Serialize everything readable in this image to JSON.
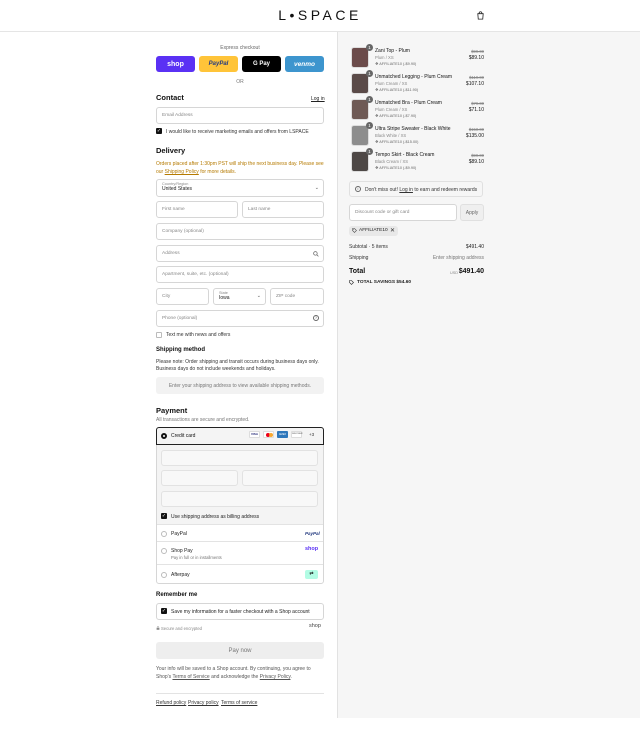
{
  "brand": {
    "logo": "L•SPACE"
  },
  "express": {
    "label": "Express checkout",
    "shop": "shop",
    "paypal": "PayPal",
    "gpay": "G Pay",
    "venmo": "venmo",
    "or": "OR"
  },
  "contact": {
    "title": "Contact",
    "login": "Log in",
    "email_placeholder": "Email Address",
    "marketing": "I would like to receive marketing emails and offers from LSPACE"
  },
  "delivery": {
    "title": "Delivery",
    "notice_a": "Orders placed after 1:30pm PST will ship the next business day. Please see our",
    "notice_link": "Shipping Policy",
    "notice_b": "for more details.",
    "country_label": "Country/Region",
    "country_value": "United States",
    "first_name": "First name",
    "last_name": "Last name",
    "company": "Company (optional)",
    "address": "Address",
    "apartment": "Apartment, suite, etc. (optional)",
    "city": "City",
    "state_label": "State",
    "state_value": "Iowa",
    "zip": "ZIP code",
    "phone": "Phone (optional)",
    "text_me": "Text me with news and offers"
  },
  "shipping_method": {
    "title": "Shipping method",
    "note_a": "Please note: Order shipping and transit occurs during business days only.",
    "note_b": "Business days do not include weekends and holidays.",
    "placeholder": "Enter your shipping address to view available shipping methods."
  },
  "payment": {
    "title": "Payment",
    "subtitle": "All transactions are secure and encrypted.",
    "credit_card": "Credit card",
    "more_cards": "+3",
    "visa": "VISA",
    "amex": "AMEX",
    "discover": "DISCOVER",
    "billing_same": "Use shipping address as billing address",
    "paypal": "PayPal",
    "paypal_logo": "PayPal",
    "shop_pay": "Shop Pay",
    "shop_pay_sub": "Pay in full or in installments",
    "shop_logo": "shop",
    "afterpay": "Afterpay"
  },
  "remember": {
    "title": "Remember me",
    "save": "Save my information for a faster checkout with a Shop account",
    "secure": "Secure and encrypted",
    "shop": "shop"
  },
  "pay_now": "Pay now",
  "terms": {
    "a": "Your info will be saved to a Shop account. By continuing, you agree to Shop's",
    "tos": "Terms of Service",
    "b": "and acknowledge the",
    "privacy": "Privacy Policy",
    "c": "."
  },
  "footer": {
    "refund": "Refund policy",
    "privacy": "Privacy policy",
    "terms": "Terms of service"
  },
  "cart": {
    "items": [
      {
        "qty": "1",
        "name": "Zani Top - Plum",
        "variant": "Plum / XS",
        "discount": "AFFILIATE10 (-$9.90)",
        "orig": "$99.00",
        "price": "$89.10",
        "img": "#6b4b4a"
      },
      {
        "qty": "1",
        "name": "Unmatched Legging - Plum Cream",
        "variant": "Plum Cream / XS",
        "discount": "AFFILIATE10 (-$11.90)",
        "orig": "$119.00",
        "price": "$107.10",
        "img": "#5a4a48"
      },
      {
        "qty": "1",
        "name": "Unmatched Bra - Plum Cream",
        "variant": "Plum Cream / XS",
        "discount": "AFFILIATE10 (-$7.90)",
        "orig": "$79.00",
        "price": "$71.10",
        "img": "#6e5a55"
      },
      {
        "qty": "1",
        "name": "Ultra Stripe Sweater - Black White",
        "variant": "Black White / XS",
        "discount": "AFFILIATE10 (-$15.00)",
        "orig": "$150.00",
        "price": "$135.00",
        "img": "#8d8d8d"
      },
      {
        "qty": "1",
        "name": "Tempo Skirt - Black Cream",
        "variant": "Black Cream / XS",
        "discount": "AFFILIATE10 (-$9.90)",
        "orig": "$99.00",
        "price": "$89.10",
        "img": "#4e4846"
      }
    ],
    "rewards_a": "Don't miss out!",
    "rewards_link": "Log in",
    "rewards_b": "to earn and redeem rewards",
    "discount_placeholder": "Discount code or gift card",
    "apply": "Apply",
    "code": "AFFILIATE10",
    "subtotal_label": "Subtotal · 5 items",
    "subtotal": "$491.40",
    "shipping_label": "Shipping",
    "shipping_value": "Enter shipping address",
    "total_label": "Total",
    "currency": "USD",
    "total": "$491.40",
    "savings_label": "TOTAL SAVINGS",
    "savings": "$54.60"
  }
}
